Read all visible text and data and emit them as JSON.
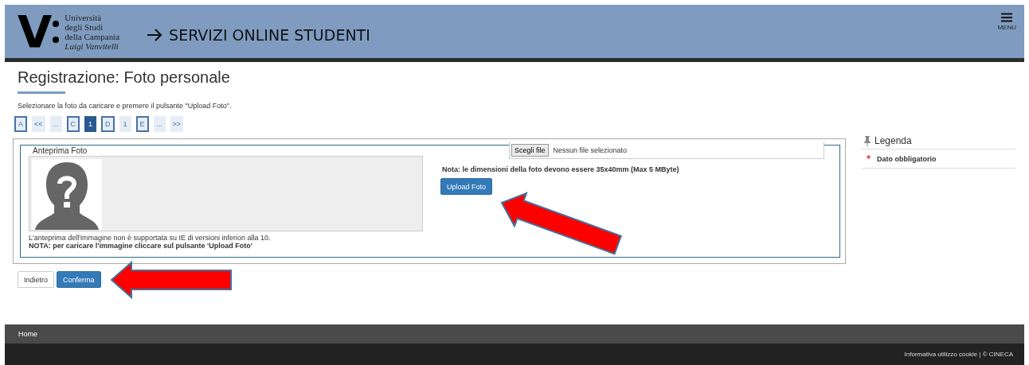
{
  "header": {
    "logo_mark": "V",
    "logo_lines": [
      "Università",
      "degli Studi",
      "della Campania"
    ],
    "logo_motto": "Luigi Vanvitelli",
    "title": "SERVIZI ONLINE STUDENTI",
    "menu_label": "MENU"
  },
  "page": {
    "title": "Registrazione: Foto personale",
    "instruction": "Selezionare la foto da caricare e premere il pulsante \"Upload Foto\"."
  },
  "pagination": [
    {
      "label": "A",
      "kind": "letter",
      "selected": false
    },
    {
      "label": "<<",
      "kind": "nav",
      "selected": false
    },
    {
      "label": "...",
      "kind": "nav",
      "selected": false
    },
    {
      "label": "C",
      "kind": "letter",
      "selected": false
    },
    {
      "label": "1",
      "kind": "nav",
      "selected": true
    },
    {
      "label": "D",
      "kind": "letter",
      "selected": false
    },
    {
      "label": "1",
      "kind": "nav",
      "selected": false
    },
    {
      "label": "E",
      "kind": "letter",
      "selected": false
    },
    {
      "label": "...",
      "kind": "nav",
      "selected": false
    },
    {
      "label": ">>",
      "kind": "nav",
      "selected": false
    }
  ],
  "preview": {
    "legend": "Anteprima Foto",
    "note": "L'anteprima dell'immagine non è supportata su IE di versioni inferiori alla 10.",
    "note_bold": "NOTA: per caricare l'immagine cliccare sul pulsante 'Upload Foto'"
  },
  "upload": {
    "file_button": "Scegli file",
    "file_status": "Nessun file selezionato",
    "size_note": "Nota: le dimensioni della foto devono essere 35x40mm (Max 5 MByte)",
    "upload_button": "Upload Foto"
  },
  "legend_panel": {
    "title": "Legenda",
    "items": [
      {
        "symbol": "*",
        "label": "Dato obbligatorio"
      }
    ]
  },
  "buttons": [
    {
      "label": "Indietro",
      "kind": "secondary"
    },
    {
      "label": "Conferma",
      "kind": "primary"
    }
  ],
  "footer": {
    "nav": "Home",
    "credits": "Informativa utilizzo cookie | © CINECA"
  }
}
